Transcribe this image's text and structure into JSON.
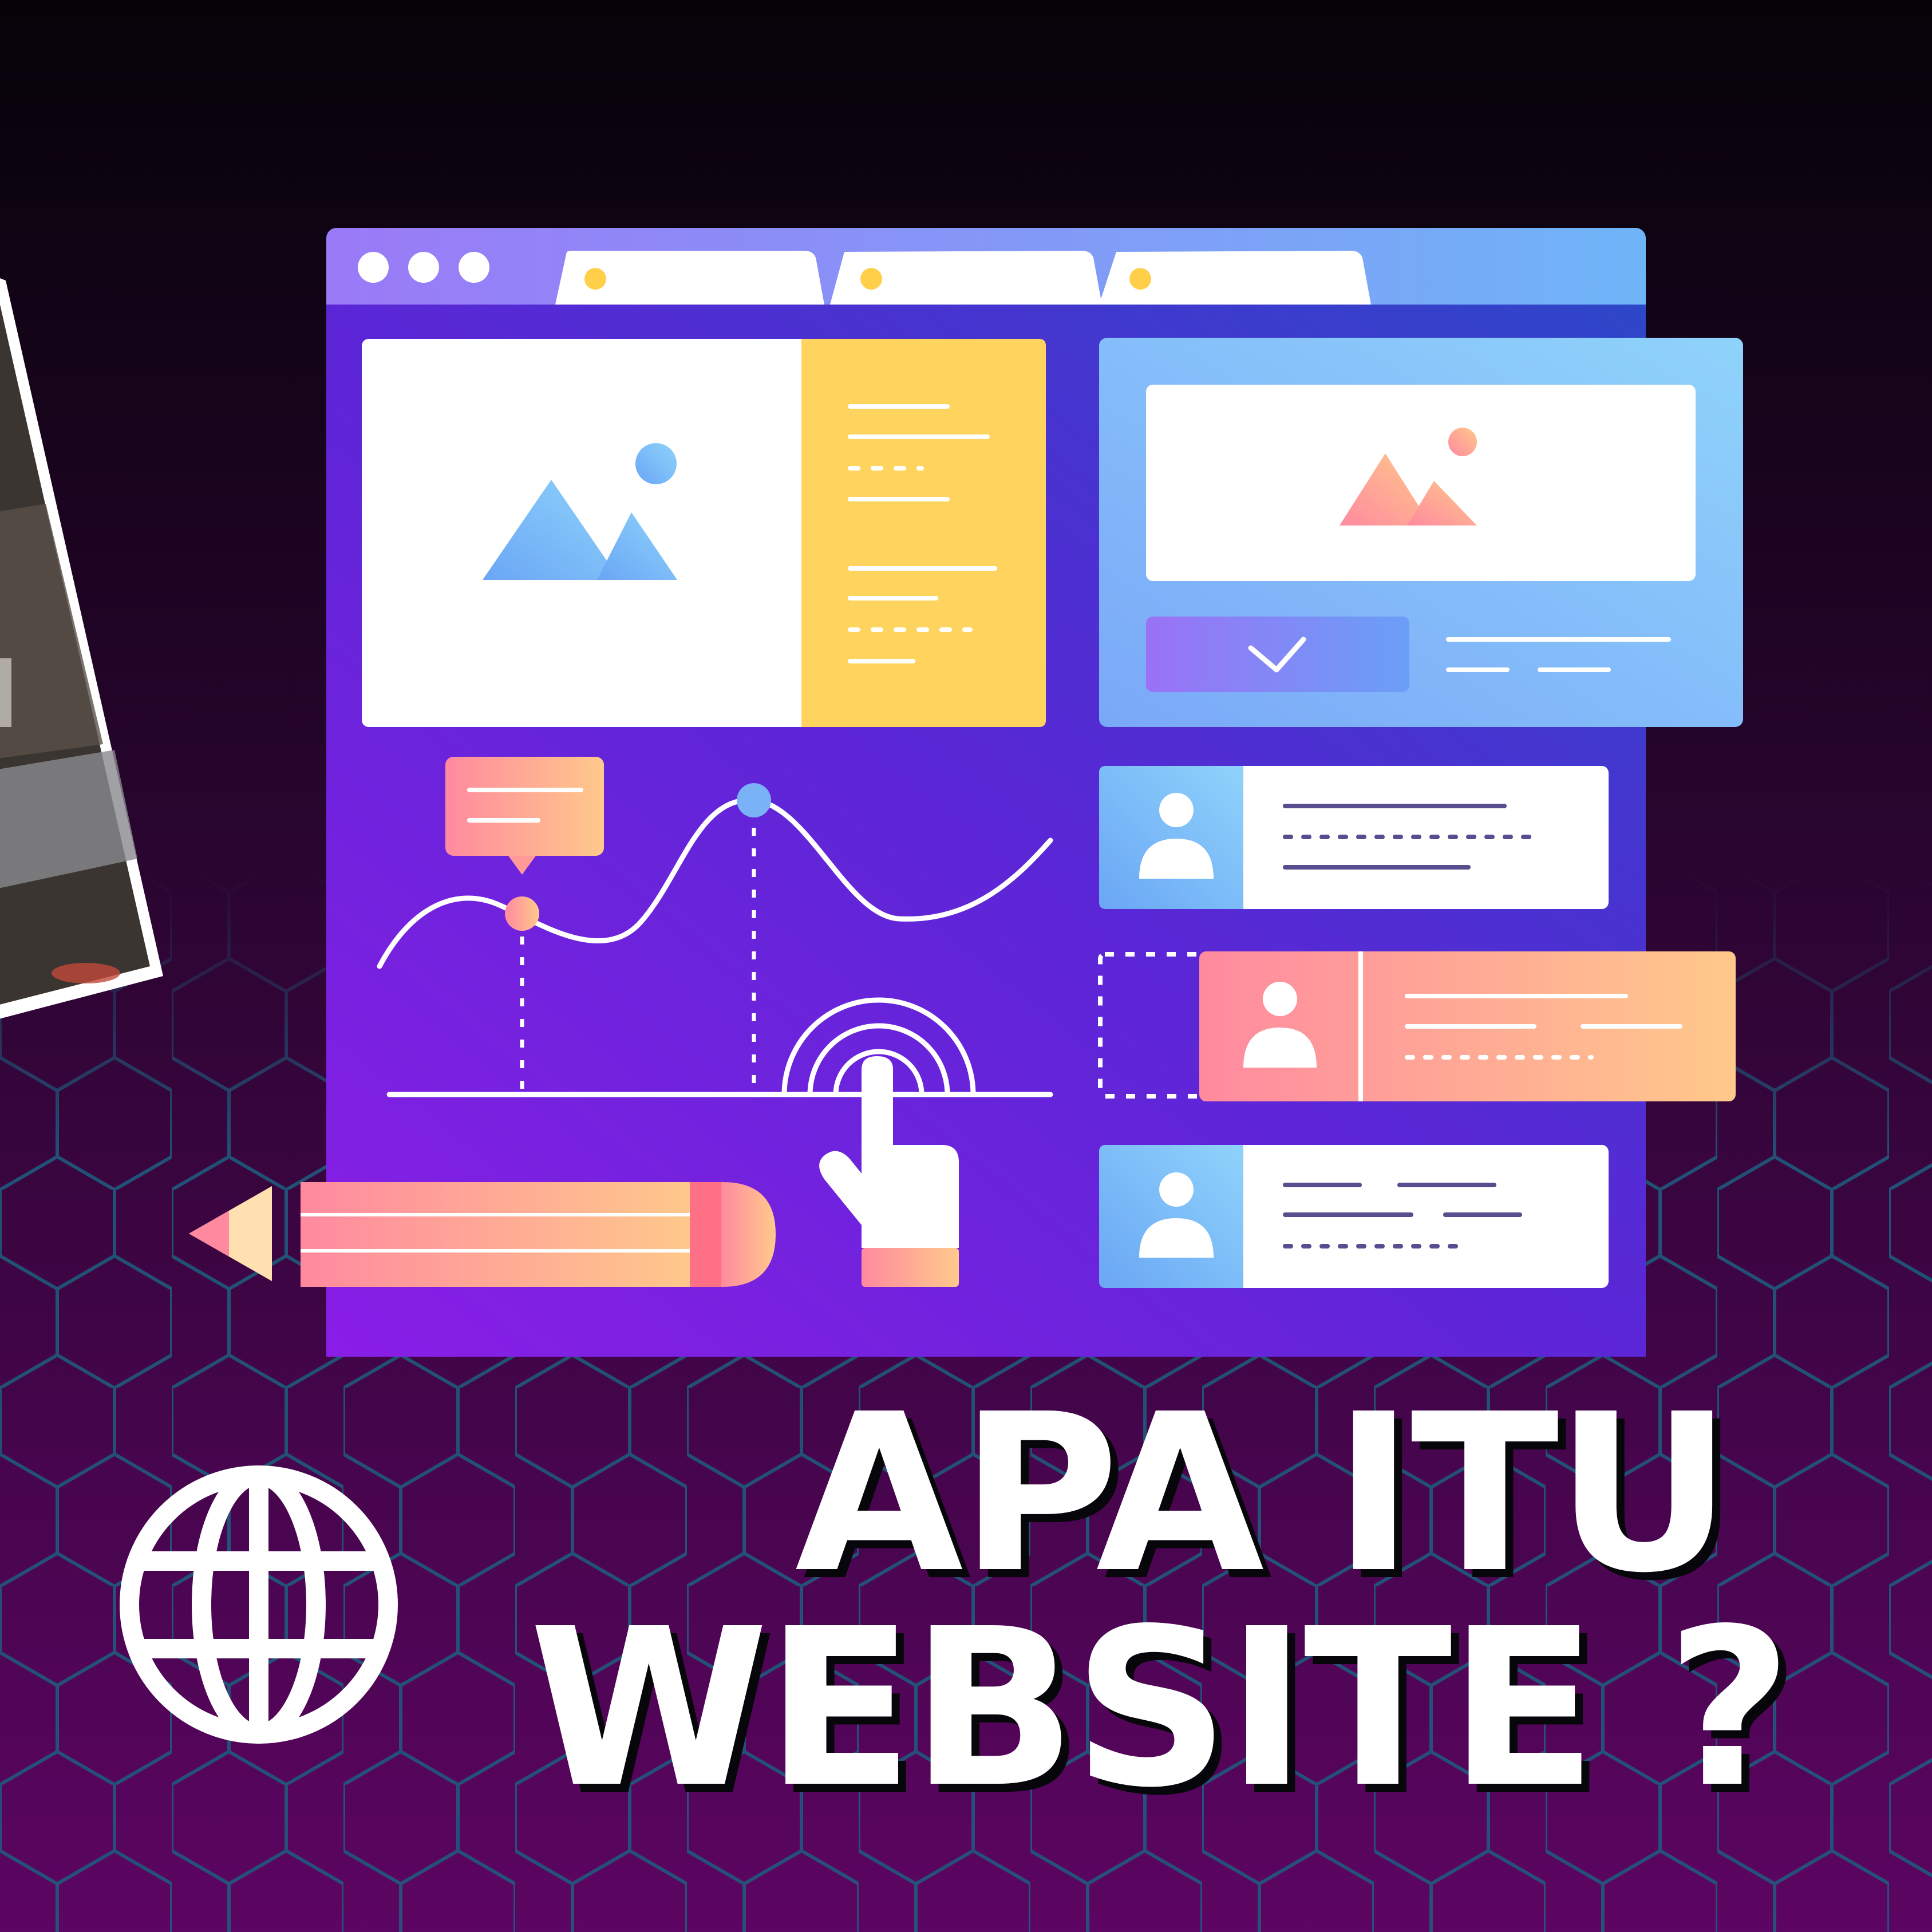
{
  "headline": {
    "line1": "APA ITU",
    "line2": "WEBSITE ?"
  },
  "colors": {
    "bg_top": "#050308",
    "bg_bottom": "#5c0562",
    "hex_grid": "#1d5f7e",
    "browser_top": "#9a7af7",
    "browser_top_right": "#6fb4f7",
    "panel_purple_top": "#5b26d6",
    "panel_purple_bottom": "#8a1ee6",
    "yellow": "#ffd45e",
    "light_blue": "#8fd3fb",
    "pink": "#ff8a9f",
    "peach": "#ffc98b",
    "white": "#ffffff",
    "dark_line": "#574d8f"
  },
  "icons": [
    "globe-icon",
    "image-icon",
    "check-icon",
    "user-icon",
    "pointer-hand-icon",
    "pencil-icon",
    "window-dots-icon"
  ]
}
